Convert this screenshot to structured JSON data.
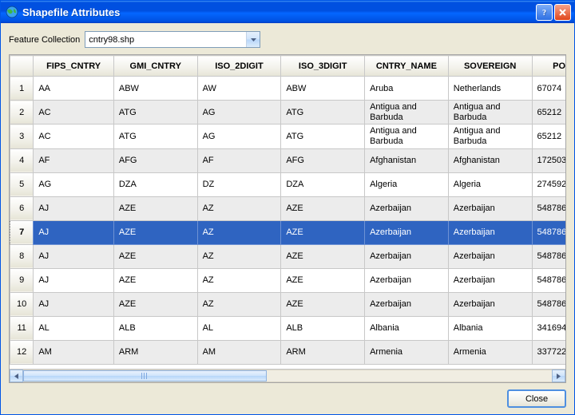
{
  "window": {
    "title": "Shapefile Attributes"
  },
  "feature_collection": {
    "label": "Feature Collection",
    "value": "cntry98.shp"
  },
  "columns": [
    "FIPS_CNTRY",
    "GMI_CNTRY",
    "ISO_2DIGIT",
    "ISO_3DIGIT",
    "CNTRY_NAME",
    "SOVEREIGN",
    "POP"
  ],
  "selected_row_index": 6,
  "rows": [
    {
      "n": "1",
      "fips": "AA",
      "gmi": "ABW",
      "iso2": "AW",
      "iso3": "ABW",
      "cntry": "Aruba",
      "sov": "Netherlands",
      "pop": "67074"
    },
    {
      "n": "2",
      "fips": "AC",
      "gmi": "ATG",
      "iso2": "AG",
      "iso3": "ATG",
      "cntry": "Antigua and Barbuda",
      "sov": "Antigua and Barbuda",
      "pop": "65212"
    },
    {
      "n": "3",
      "fips": "AC",
      "gmi": "ATG",
      "iso2": "AG",
      "iso3": "ATG",
      "cntry": "Antigua and Barbuda",
      "sov": "Antigua and Barbuda",
      "pop": "65212"
    },
    {
      "n": "4",
      "fips": "AF",
      "gmi": "AFG",
      "iso2": "AF",
      "iso3": "AFG",
      "cntry": "Afghanistan",
      "sov": "Afghanistan",
      "pop": "172503"
    },
    {
      "n": "5",
      "fips": "AG",
      "gmi": "DZA",
      "iso2": "DZ",
      "iso3": "DZA",
      "cntry": "Algeria",
      "sov": "Algeria",
      "pop": "274592"
    },
    {
      "n": "6",
      "fips": "AJ",
      "gmi": "AZE",
      "iso2": "AZ",
      "iso3": "AZE",
      "cntry": "Azerbaijan",
      "sov": "Azerbaijan",
      "pop": "548786"
    },
    {
      "n": "7",
      "fips": "AJ",
      "gmi": "AZE",
      "iso2": "AZ",
      "iso3": "AZE",
      "cntry": "Azerbaijan",
      "sov": "Azerbaijan",
      "pop": "548786"
    },
    {
      "n": "8",
      "fips": "AJ",
      "gmi": "AZE",
      "iso2": "AZ",
      "iso3": "AZE",
      "cntry": "Azerbaijan",
      "sov": "Azerbaijan",
      "pop": "548786"
    },
    {
      "n": "9",
      "fips": "AJ",
      "gmi": "AZE",
      "iso2": "AZ",
      "iso3": "AZE",
      "cntry": "Azerbaijan",
      "sov": "Azerbaijan",
      "pop": "548786"
    },
    {
      "n": "10",
      "fips": "AJ",
      "gmi": "AZE",
      "iso2": "AZ",
      "iso3": "AZE",
      "cntry": "Azerbaijan",
      "sov": "Azerbaijan",
      "pop": "548786"
    },
    {
      "n": "11",
      "fips": "AL",
      "gmi": "ALB",
      "iso2": "AL",
      "iso3": "ALB",
      "cntry": "Albania",
      "sov": "Albania",
      "pop": "341694"
    },
    {
      "n": "12",
      "fips": "AM",
      "gmi": "ARM",
      "iso2": "AM",
      "iso3": "ARM",
      "cntry": "Armenia",
      "sov": "Armenia",
      "pop": "337722"
    }
  ],
  "buttons": {
    "close": "Close"
  }
}
